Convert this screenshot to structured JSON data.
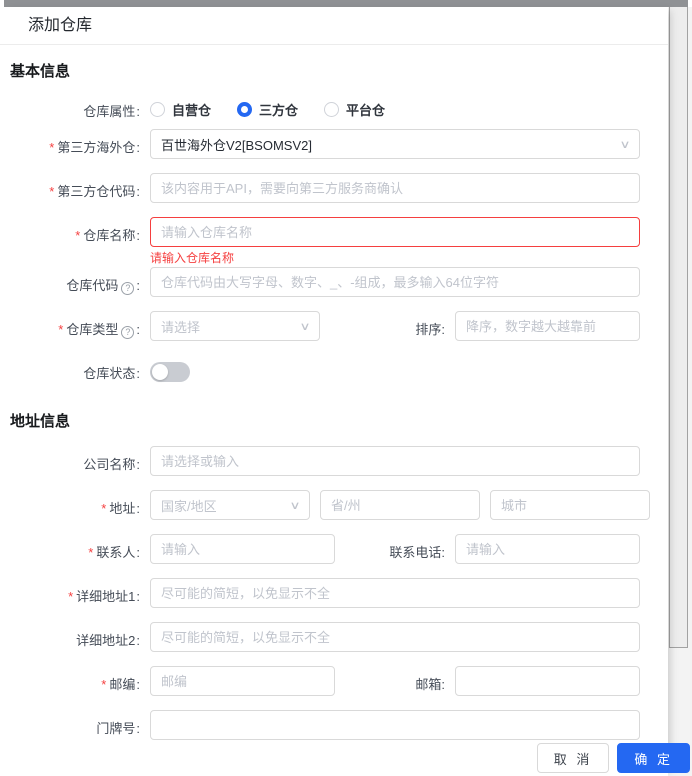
{
  "ui": {
    "colon": ":",
    "required_mark": "*",
    "icons": {
      "help": "?",
      "chevron": "∨"
    }
  },
  "dialog": {
    "title": "添加仓库",
    "footer": {
      "cancel": "取 消",
      "confirm": "确 定"
    }
  },
  "sections": {
    "basic": "基本信息",
    "address": "地址信息"
  },
  "fields": {
    "warehouse_attr": {
      "label": "仓库属性",
      "options": [
        "自营仓",
        "三方仓",
        "平台仓"
      ],
      "selected": "三方仓"
    },
    "third_party_warehouse": {
      "label": "第三方海外仓",
      "value": "百世海外仓V2[BSOMSV2]"
    },
    "third_party_code": {
      "label": "第三方仓代码",
      "placeholder": "该内容用于API，需要向第三方服务商确认"
    },
    "warehouse_name": {
      "label": "仓库名称",
      "placeholder": "请输入仓库名称",
      "error": "请输入仓库名称"
    },
    "warehouse_code": {
      "label": "仓库代码",
      "placeholder": "仓库代码由大写字母、数字、_、-组成，最多输入64位字符"
    },
    "warehouse_type": {
      "label": "仓库类型",
      "placeholder": "请选择"
    },
    "sort": {
      "label": "排序",
      "placeholder": "降序，数字越大越靠前"
    },
    "warehouse_status": {
      "label": "仓库状态",
      "state": "off"
    },
    "company_name": {
      "label": "公司名称",
      "placeholder": "请选择或输入"
    },
    "address": {
      "label": "地址",
      "country_placeholder": "国家/地区",
      "state_placeholder": "省/州",
      "city_placeholder": "城市"
    },
    "contact": {
      "label": "联系人",
      "placeholder": "请输入"
    },
    "contact_phone": {
      "label": "联系电话",
      "placeholder": "请输入"
    },
    "address1": {
      "label": "详细地址1",
      "placeholder": "尽可能的简短，以免显示不全"
    },
    "address2": {
      "label": "详细地址2",
      "placeholder": "尽可能的简短，以免显示不全"
    },
    "zip": {
      "label": "邮编",
      "placeholder": "邮编"
    },
    "email": {
      "label": "邮箱"
    },
    "house_number": {
      "label": "门牌号"
    }
  },
  "colors": {
    "primary": "#2468f2",
    "error": "#f53f3f"
  }
}
